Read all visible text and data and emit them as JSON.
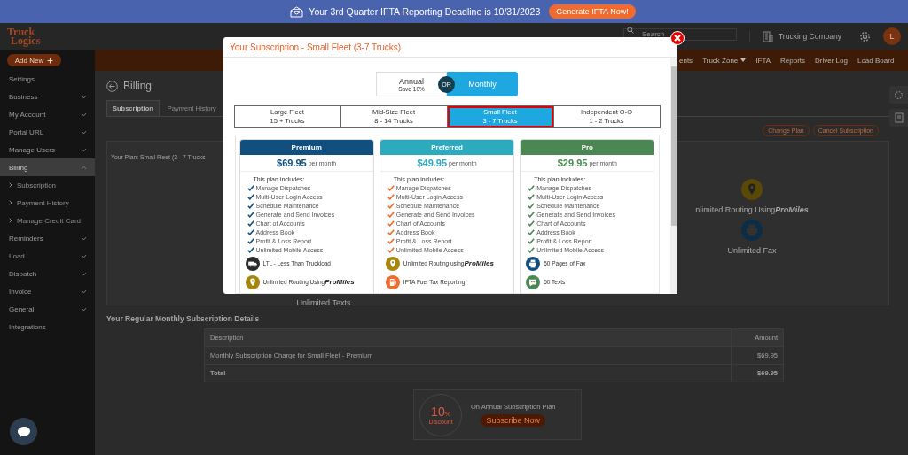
{
  "banner": {
    "text": "Your 3rd Quarter IFTA Reporting Deadline is 10/31/2023",
    "button": "Generate IFTA Now!"
  },
  "header": {
    "logo": [
      "Truck",
      "Logics"
    ],
    "search_placeholder": "Search",
    "company": "Trucking Company",
    "avatar": "L"
  },
  "nav": [
    {
      "label": "ents",
      "dropdown": false
    },
    {
      "label": "Truck Zone",
      "dropdown": true
    },
    {
      "label": "IFTA",
      "dropdown": false
    },
    {
      "label": "Reports",
      "dropdown": false
    },
    {
      "label": "Driver Log",
      "dropdown": false
    },
    {
      "label": "Load Board",
      "dropdown": false
    }
  ],
  "sidebar": {
    "add_button": "Add New",
    "items": [
      {
        "label": "Settings",
        "kind": "link",
        "selected": false
      },
      {
        "label": "Business",
        "kind": "group",
        "expanded": false,
        "selected": false
      },
      {
        "label": "My Account",
        "kind": "group",
        "expanded": false,
        "selected": false
      },
      {
        "label": "Portal URL",
        "kind": "group",
        "expanded": false,
        "selected": false
      },
      {
        "label": "Manage Users",
        "kind": "group",
        "expanded": false,
        "selected": false
      },
      {
        "label": "Billing",
        "kind": "group",
        "expanded": true,
        "selected": true,
        "children": [
          {
            "label": "Subscription"
          },
          {
            "label": "Payment History"
          },
          {
            "label": "Manage Credit Card"
          }
        ]
      },
      {
        "label": "Reminders",
        "kind": "group",
        "expanded": false,
        "selected": false
      },
      {
        "label": "Load",
        "kind": "group",
        "expanded": false,
        "selected": false
      },
      {
        "label": "Dispatch",
        "kind": "group",
        "expanded": false,
        "selected": false
      },
      {
        "label": "Invoice",
        "kind": "group",
        "expanded": false,
        "selected": false
      },
      {
        "label": "General",
        "kind": "group",
        "expanded": false,
        "selected": false
      },
      {
        "label": "Integrations",
        "kind": "link",
        "selected": false
      }
    ]
  },
  "page": {
    "title": "Billing",
    "tabs": [
      {
        "label": "Subscription",
        "selected": true
      },
      {
        "label": "Payment History",
        "selected": false
      }
    ],
    "plan_title": "Your Plan: Small Fleet (3 - 7 Trucks",
    "actions": [
      "Change Plan",
      "Cancel Subscription"
    ],
    "features": [
      {
        "kind": "routing",
        "label": "nlimited Routing Using",
        "logo": "ProMiles"
      },
      {
        "kind": "fax",
        "label": "Unlimited Fax"
      },
      {
        "kind": "texts",
        "label": "Unlimited Texts"
      }
    ]
  },
  "details": {
    "title": "Your Regular Monthly Subscription Details",
    "columns": [
      "Description",
      "Amount"
    ],
    "rows": [
      {
        "description": "Monthly Subscription Charge for Small Fleet - Premium",
        "amount": "$69.95"
      }
    ],
    "total": {
      "label": "Total",
      "amount": "$69.95"
    }
  },
  "promo": {
    "percent": "10",
    "unit": "%",
    "label": "Discount",
    "text": "On Annual Subscription Plan",
    "button": "Subscribe Now"
  },
  "modal": {
    "title": "Your Subscription - Small Fleet (3-7 Trucks)",
    "billing": [
      {
        "label": "Annual",
        "note": "Save 10%",
        "selected": false
      },
      {
        "label": "Monthly",
        "selected": true
      }
    ],
    "separator": "OR",
    "fleets": [
      {
        "name": "Large Fleet",
        "trucks": "15 + Trucks",
        "selected": false
      },
      {
        "name": "Mid-Size Fleet",
        "trucks": "8 - 14 Trucks",
        "selected": false
      },
      {
        "name": "Small Fleet",
        "trucks": "3 - 7 Trucks",
        "selected": true
      },
      {
        "name": "Independent O-O",
        "trucks": "1 - 2 Trucks",
        "selected": false
      }
    ],
    "plans": [
      {
        "name": "Premium",
        "color": "#11507e",
        "check": {
          "color": "#11507e"
        },
        "price": "$69.95",
        "period": "per month",
        "intro": "This plan includes:",
        "features": [
          "Manage Dispatches",
          "Multi-User Login Access",
          "Schedule Maintenance",
          "Generate and Send Invoices",
          "Chart of Accounts",
          "Address Book",
          "Profit & Loss Report",
          "Unlimited Mobile Access"
        ],
        "extras": [
          {
            "kind": "ltl",
            "label": "LTL - Less Than Truckload"
          },
          {
            "kind": "routing",
            "label": "Unlimited Routing Using",
            "logo": "ProMiles"
          }
        ]
      },
      {
        "name": "Preferred",
        "color": "#2eaabf",
        "check": {
          "color": "#f26b2e"
        },
        "price": "$49.95",
        "period": "per month",
        "intro": "This plan includes:",
        "features": [
          "Manage Dispatches",
          "Multi-User Login Access",
          "Schedule Maintenance",
          "Generate and Send Invoices",
          "Chart of Accounts",
          "Address Book",
          "Profit & Loss Report",
          "Unlimited Mobile Access"
        ],
        "extras": [
          {
            "kind": "routing",
            "label": "Unlimited Routing using",
            "logo": "ProMiles"
          },
          {
            "kind": "ifta",
            "label": "IFTA Fuel Tax Reporting"
          }
        ]
      },
      {
        "name": "Pro",
        "color": "#4a8753",
        "check": {
          "color": "#4a8753"
        },
        "price": "$29.95",
        "period": "per month",
        "intro": "This plan includes:",
        "features": [
          "Manage Dispatches",
          "Multi-User Login Access",
          "Schedule Maintenance",
          "Generate and Send Invoices",
          "Chart of Accounts",
          "Address Book",
          "Profit & Loss Report",
          "Unlimited Mobile Access"
        ],
        "extras": [
          {
            "kind": "fax",
            "label": "50 Pages of Fax"
          },
          {
            "kind": "texts",
            "label": "50 Texts"
          }
        ]
      }
    ]
  }
}
